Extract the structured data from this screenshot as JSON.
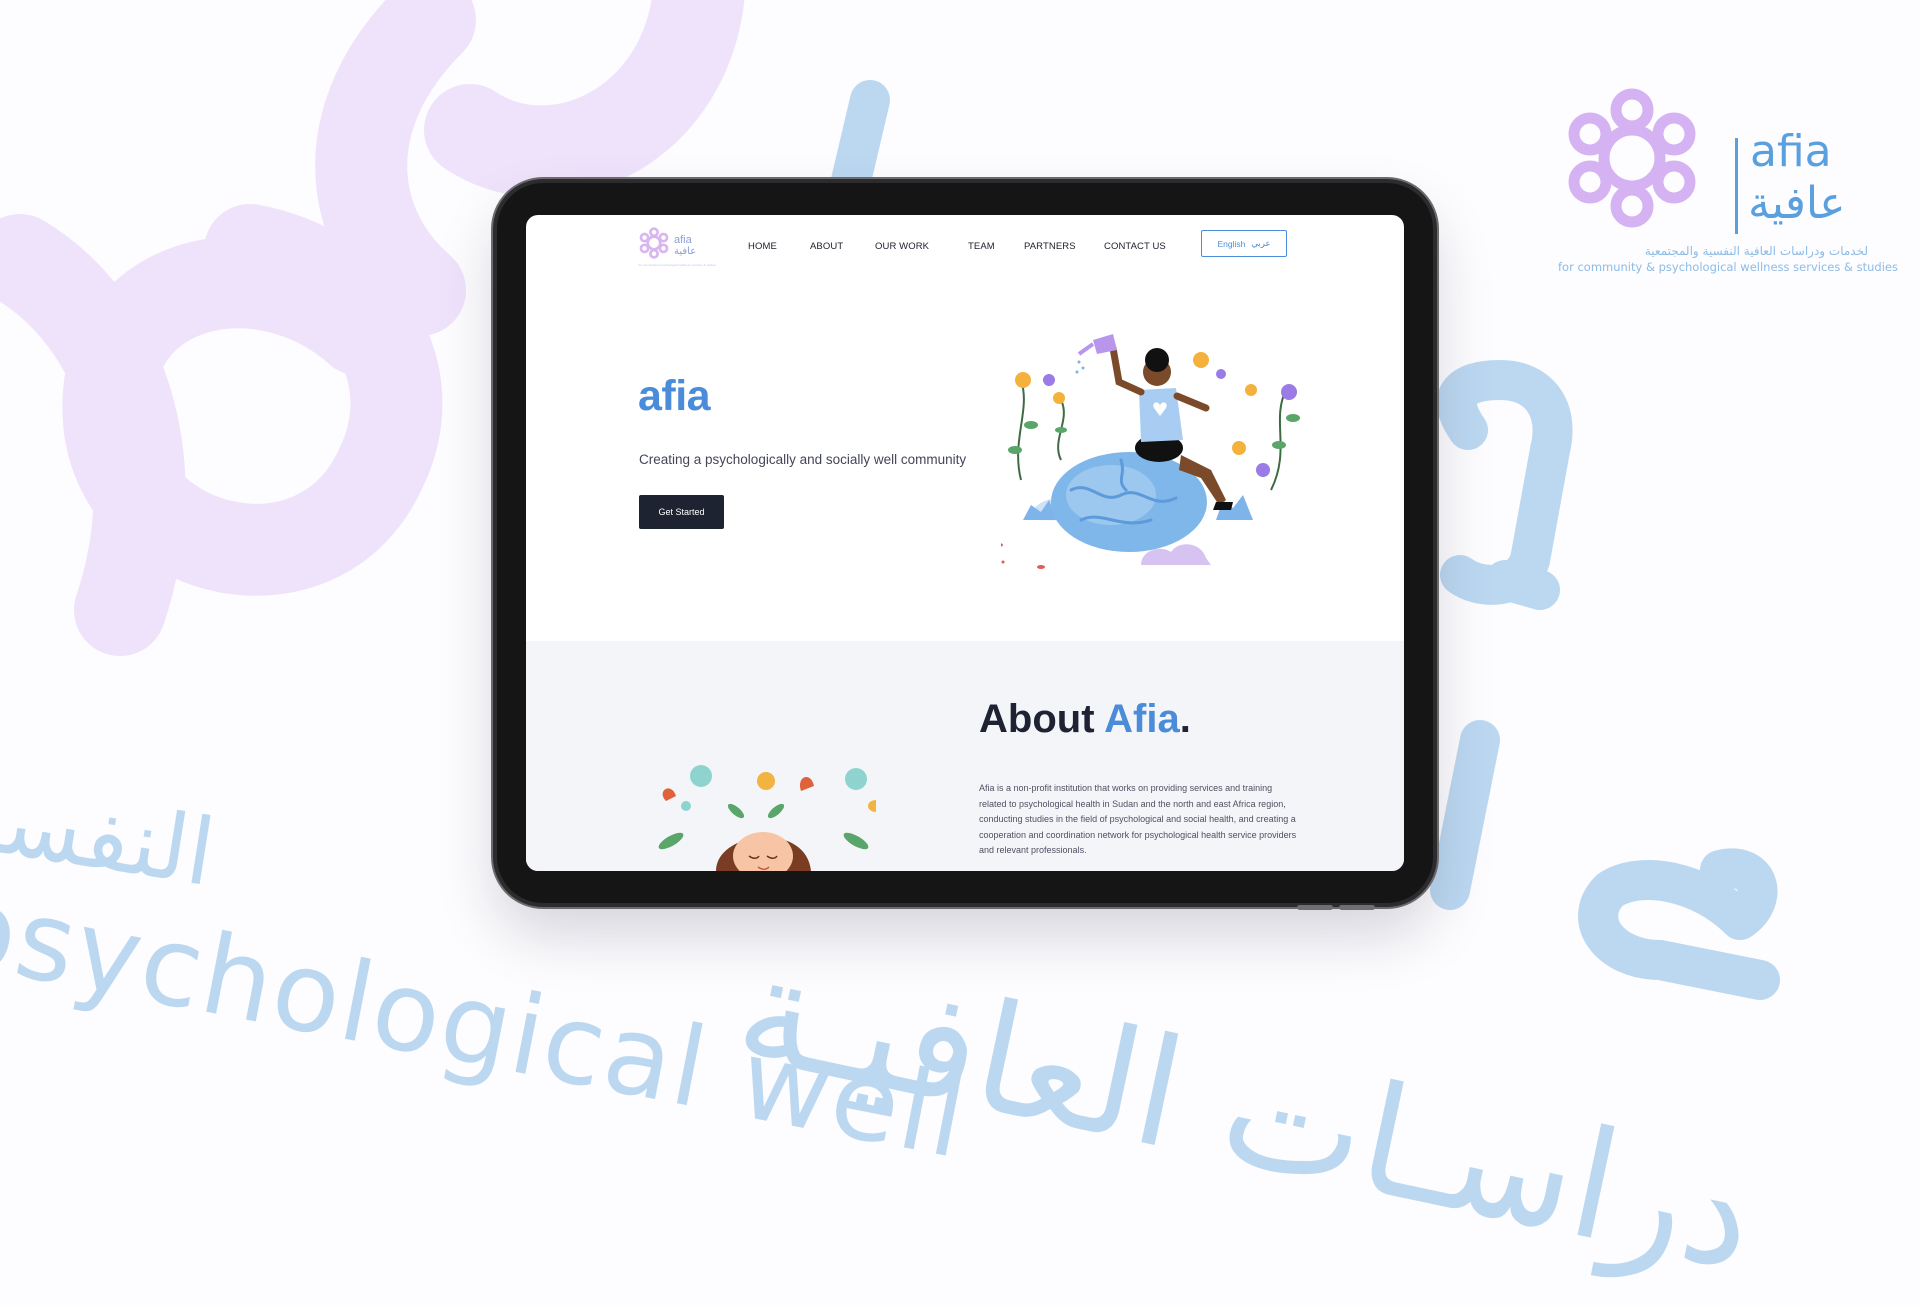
{
  "brand": {
    "latin": "afia",
    "arabic": "عافية",
    "tagline_ar": "لخدمات ودراسات العافية النفسية والمجتمعية",
    "tagline_en": "for community & psychological wellness services & studies"
  },
  "background_text": {
    "arabic_1": "النفسيـ",
    "latin": "psychological well",
    "arabic_2": "دراسـات العافيـة"
  },
  "site": {
    "logo": {
      "latin": "afia",
      "arabic": "عافية",
      "tagline": "for community & psychological wellness services & studies"
    },
    "nav": [
      "HOME",
      "ABOUT",
      "OUR WORK",
      "TEAM",
      "PARTNERS",
      "CONTACT US"
    ],
    "language": {
      "english": "English",
      "arabic": "عربي"
    },
    "hero": {
      "title": "afia",
      "subtitle": "Creating a psychologically and socially well community",
      "button": "Get Started"
    },
    "about": {
      "title_prefix": "About ",
      "title_accent": "Afia",
      "title_suffix": ".",
      "body": "Afia is a non-profit institution that works on providing services and training related to psychological health in Sudan and the north and east Africa region, conducting studies in the field of psychological and social health, and creating a cooperation and coordination network for psychological health service providers and relevant professionals."
    }
  },
  "colors": {
    "accent_blue": "#4a8cd9",
    "brand_purple": "#d5b2f2",
    "dark_button": "#1d2331",
    "background_lavender": "#efe3fc",
    "background_blue": "#bcd8f1"
  }
}
